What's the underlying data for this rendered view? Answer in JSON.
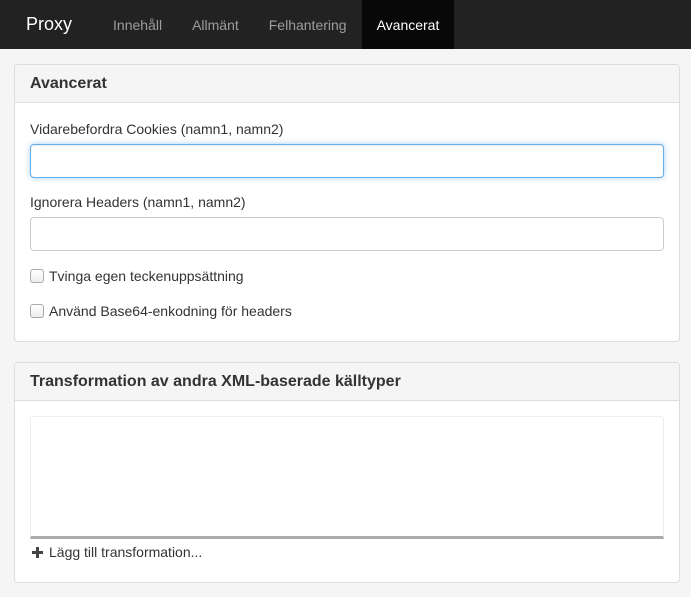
{
  "navbar": {
    "brand": "Proxy",
    "tabs": [
      {
        "label": "Innehåll",
        "active": false
      },
      {
        "label": "Allmänt",
        "active": false
      },
      {
        "label": "Felhantering",
        "active": false
      },
      {
        "label": "Avancerat",
        "active": true
      }
    ]
  },
  "advanced_panel": {
    "title": "Avancerat",
    "forward_cookies": {
      "label": "Vidarebefordra Cookies (namn1, namn2)",
      "value": "",
      "placeholder": ""
    },
    "ignore_headers": {
      "label": "Ignorera Headers (namn1, namn2)",
      "value": "",
      "placeholder": ""
    },
    "force_charset": {
      "label": "Tvinga egen teckenuppsättning",
      "checked": false
    },
    "base64_headers": {
      "label": "Använd Base64-enkodning för headers",
      "checked": false
    }
  },
  "transform_panel": {
    "title": "Transformation av andra XML-baserade källtyper",
    "add_label": "Lägg till transformation..."
  },
  "colors": {
    "navbar_bg": "#222222",
    "active_tab_bg": "#080808",
    "focus_border": "#66afe9"
  }
}
